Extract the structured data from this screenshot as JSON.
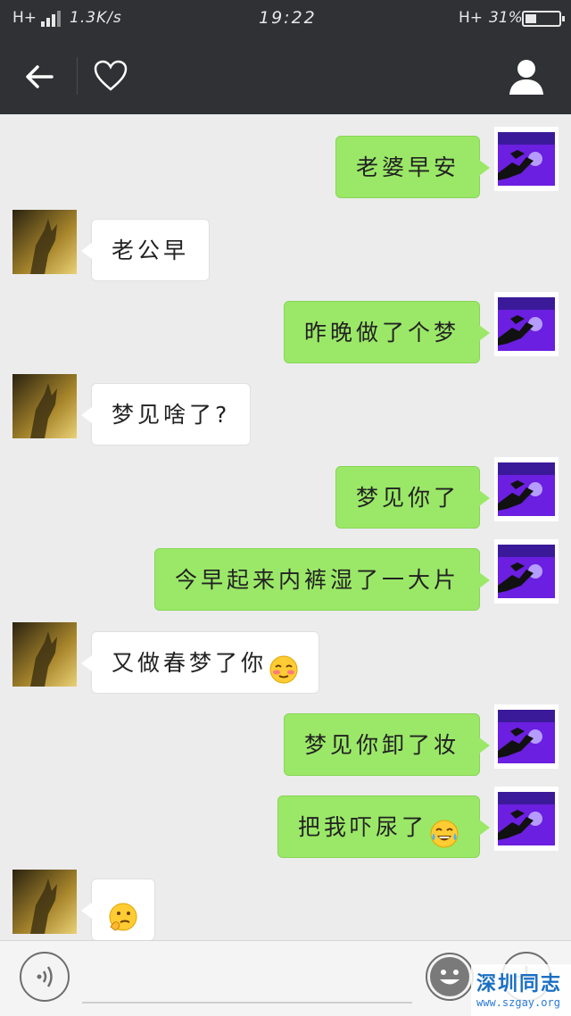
{
  "status_bar": {
    "network_left": "H+",
    "speed": "1.3K/s",
    "time": "19:22",
    "network_right": "H+",
    "battery_percent": "31%"
  },
  "nav": {
    "back_icon": "back-arrow-icon",
    "favorite_icon": "heart-icon",
    "profile_icon": "person-icon"
  },
  "messages": [
    {
      "side": "out",
      "text": "老婆早安"
    },
    {
      "side": "in",
      "text": "老公早"
    },
    {
      "side": "out",
      "text": "昨晚做了个梦"
    },
    {
      "side": "in",
      "text": "梦见啥了?"
    },
    {
      "side": "out",
      "text": "梦见你了"
    },
    {
      "side": "out",
      "text": "今早起来内裤湿了一大片"
    },
    {
      "side": "in",
      "text": "又做春梦了你",
      "emoji": "blush-face-emoji"
    },
    {
      "side": "out",
      "text": "梦见你卸了妆"
    },
    {
      "side": "out",
      "text": "把我吓尿了",
      "emoji": "tears-of-joy-emoji"
    },
    {
      "side": "in",
      "text": "",
      "emoji": "thinking-face-emoji"
    }
  ],
  "input_bar": {
    "voice_icon": "voice-icon",
    "emoji_icon": "emoji-icon",
    "plus_icon": "plus-icon"
  },
  "watermark": {
    "title": "深圳同志",
    "url": "www.szgay.org"
  },
  "colors": {
    "header": "#2f3135",
    "chat_background": "#ececec",
    "outgoing_bubble": "#9be868",
    "incoming_bubble": "#ffffff"
  }
}
